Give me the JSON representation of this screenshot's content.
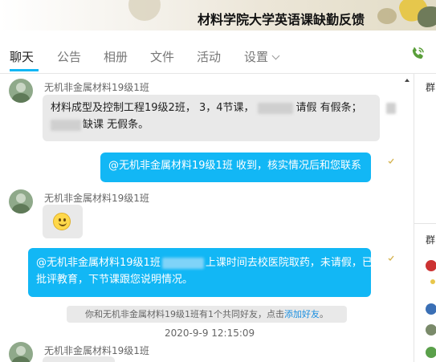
{
  "window": {
    "title": "材料学院大学英语课缺勤反馈"
  },
  "tabs": [
    {
      "label": "聊天",
      "active": true
    },
    {
      "label": "公告"
    },
    {
      "label": "相册"
    },
    {
      "label": "文件"
    },
    {
      "label": "活动"
    },
    {
      "label": "设置"
    }
  ],
  "messages": {
    "m1": {
      "sender": "无机非金属材料19级1班",
      "line1_a": "材料成型及控制工程19级2班， 3，4节课，",
      "line1_b": "请假 有假条；",
      "line2_b": "缺课 无假条。"
    },
    "m2": {
      "text": "@无机非金属材料19级1班 收到，核实情况后和您联系"
    },
    "m3": {
      "sender": "无机非金属材料19级1班",
      "emoji": "smiley-emoji"
    },
    "m4": {
      "line1_a": "@无机非金属材料19级1班",
      "line1_b": "上课时间去校医院取药，未请假，已",
      "line2": "批评教育，下节课跟您说明情况。"
    },
    "system": {
      "text": "你和无机非金属材料19级1班有1个共同好友，点击",
      "link": "添加好友",
      "end": "。"
    },
    "timestamp": "2020-9-9 12:15:09",
    "m5": {
      "sender": "无机非金属材料19级1班"
    }
  },
  "right_panel": {
    "label_top": "群",
    "label_mid": "群"
  },
  "colors": {
    "accent": "#12b7f5",
    "in_bubble": "#e9e9e9"
  }
}
